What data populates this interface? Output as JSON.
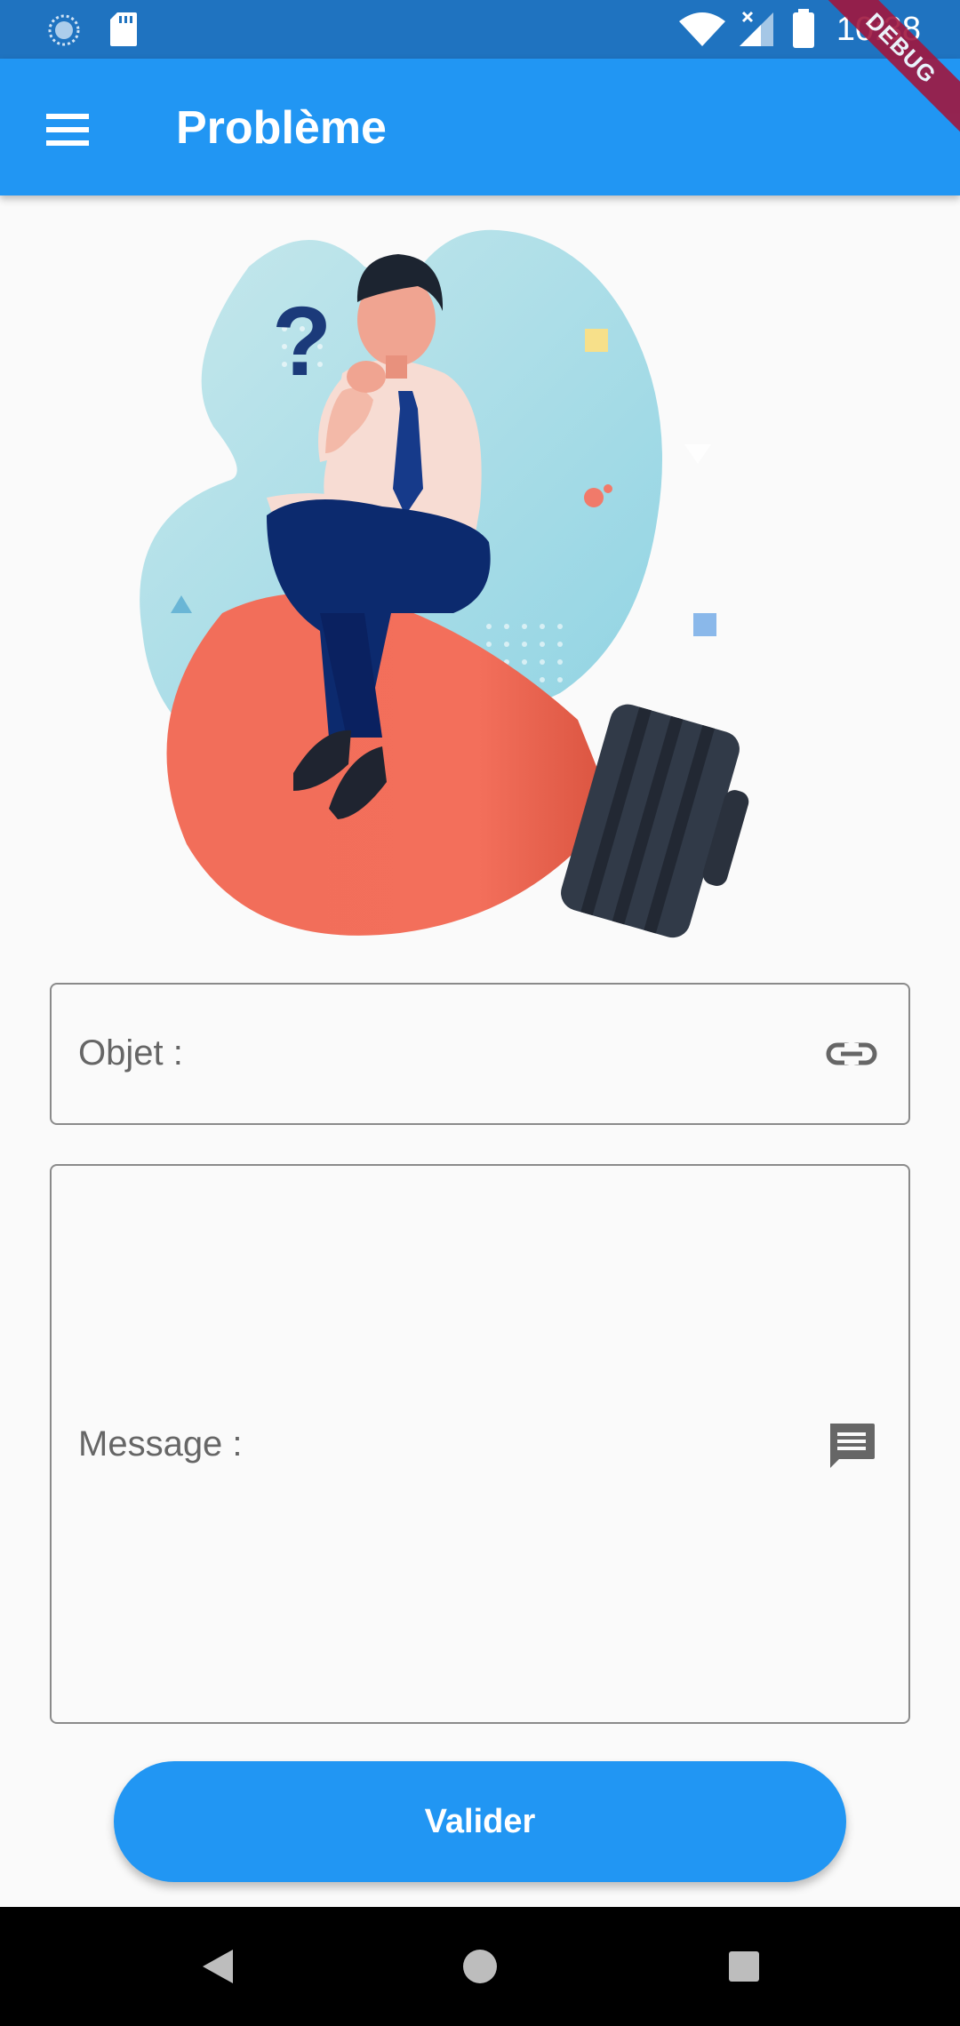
{
  "status_bar": {
    "time": "10:38",
    "icons": [
      "sync-icon",
      "sd-card-icon",
      "wifi-icon",
      "cell-signal-icon",
      "battery-icon"
    ]
  },
  "debug_banner": "DEBUG",
  "app_bar": {
    "title": "Problème",
    "menu_icon": "menu-icon"
  },
  "form": {
    "objet": {
      "label": "Objet :",
      "icon": "link-icon",
      "value": ""
    },
    "message": {
      "label": "Message :",
      "icon": "message-icon",
      "value": ""
    },
    "submit_label": "Valider"
  },
  "nav_bar": {
    "buttons": [
      "back-icon",
      "home-icon",
      "recents-icon"
    ]
  },
  "colors": {
    "primary": "#2196f3",
    "status_bar": "#1f73c0",
    "background": "#fafafa",
    "border": "#8a8a8a",
    "debug": "#a0173f"
  }
}
